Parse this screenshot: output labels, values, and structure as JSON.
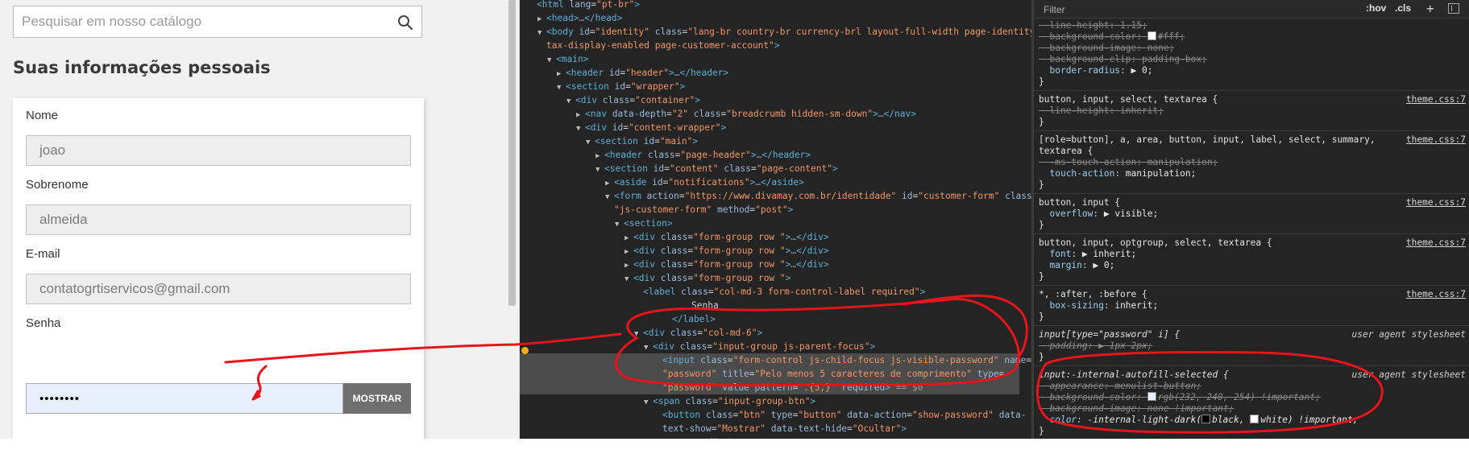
{
  "page": {
    "search": {
      "placeholder": "Pesquisar em nosso catálogo",
      "icon": "search-icon"
    },
    "title": "Suas informações pessoais",
    "fields": [
      {
        "label": "Nome",
        "value": "joao"
      },
      {
        "label": "Sobrenome",
        "value": "almeida"
      },
      {
        "label": "E-mail",
        "value": "contatogrtiservicos@gmail.com"
      },
      {
        "label": "Senha",
        "value": "••••••••"
      }
    ],
    "show_button": "MOSTRAR"
  },
  "elements_panel": {
    "lines": [
      {
        "indent": 0,
        "html": "<span class='tg'>&lt;html</span> <span class='an'>lang</span>=<span class='av'>\"pt-br\"</span><span class='tg'>&gt;</span>"
      },
      {
        "indent": 1,
        "tri": "▶",
        "html": "<span class='tg'>&lt;head&gt;</span><span class='dm'>…</span><span class='tg'>&lt;/head&gt;</span>"
      },
      {
        "indent": 1,
        "tri": "▼",
        "html": "<span class='tg'>&lt;body</span> <span class='an'>id</span>=<span class='av'>\"identity\"</span> <span class='an'>class</span>=<span class='av'>\"lang-br country-br currency-brl layout-full-width page-identity</span>"
      },
      {
        "indent": 1,
        "html": "<span class='av'>tax-display-enabled page-customer-account\"</span><span class='tg'>&gt;</span>"
      },
      {
        "indent": 2,
        "tri": "▼",
        "html": "<span class='tg'>&lt;main&gt;</span>"
      },
      {
        "indent": 3,
        "tri": "▶",
        "html": "<span class='tg'>&lt;header</span> <span class='an'>id</span>=<span class='av'>\"header\"</span><span class='tg'>&gt;</span><span class='dm'>…</span><span class='tg'>&lt;/header&gt;</span>"
      },
      {
        "indent": 3,
        "tri": "▼",
        "html": "<span class='tg'>&lt;section</span> <span class='an'>id</span>=<span class='av'>\"wrapper\"</span><span class='tg'>&gt;</span>"
      },
      {
        "indent": 4,
        "tri": "▼",
        "html": "<span class='tg'>&lt;div</span> <span class='an'>class</span>=<span class='av'>\"container\"</span><span class='tg'>&gt;</span>"
      },
      {
        "indent": 5,
        "tri": "▶",
        "html": "<span class='tg'>&lt;nav</span> <span class='an'>data-depth</span>=<span class='av'>\"2\"</span> <span class='an'>class</span>=<span class='av'>\"breadcrumb hidden-sm-down\"</span><span class='tg'>&gt;</span><span class='dm'>…</span><span class='tg'>&lt;/nav&gt;</span>"
      },
      {
        "indent": 5,
        "tri": "▼",
        "html": "<span class='tg'>&lt;div</span> <span class='an'>id</span>=<span class='av'>\"content-wrapper\"</span><span class='tg'>&gt;</span>"
      },
      {
        "indent": 6,
        "tri": "▼",
        "html": "<span class='tg'>&lt;section</span> <span class='an'>id</span>=<span class='av'>\"main\"</span><span class='tg'>&gt;</span>"
      },
      {
        "indent": 7,
        "tri": "▶",
        "html": "<span class='tg'>&lt;header</span> <span class='an'>class</span>=<span class='av'>\"page-header\"</span><span class='tg'>&gt;</span><span class='dm'>…</span><span class='tg'>&lt;/header&gt;</span>"
      },
      {
        "indent": 7,
        "tri": "▼",
        "html": "<span class='tg'>&lt;section</span> <span class='an'>id</span>=<span class='av'>\"content\"</span> <span class='an'>class</span>=<span class='av'>\"page-content\"</span><span class='tg'>&gt;</span>"
      },
      {
        "indent": 8,
        "tri": "▶",
        "html": "<span class='tg'>&lt;aside</span> <span class='an'>id</span>=<span class='av'>\"notifications\"</span><span class='tg'>&gt;</span><span class='dm'>…</span><span class='tg'>&lt;/aside&gt;</span>"
      },
      {
        "indent": 8,
        "tri": "▼",
        "html": "<span class='tg'>&lt;form</span> <span class='an'>action</span>=<span class='av'>\"https://www.divamay.com.br/identidade\"</span> <span class='an'>id</span>=<span class='av'>\"customer-form\"</span> <span class='an'>class</span>="
      },
      {
        "indent": 8,
        "html": "<span class='av'>\"js-customer-form\"</span> <span class='an'>method</span>=<span class='av'>\"post\"</span><span class='tg'>&gt;</span>"
      },
      {
        "indent": 9,
        "tri": "▼",
        "html": "<span class='tg'>&lt;section&gt;</span>"
      },
      {
        "indent": 10,
        "tri": "▶",
        "html": "<span class='tg'>&lt;div</span> <span class='an'>class</span>=<span class='av'>\"form-group row \"</span><span class='tg'>&gt;</span><span class='dm'>…</span><span class='tg'>&lt;/div&gt;</span>"
      },
      {
        "indent": 10,
        "tri": "▶",
        "html": "<span class='tg'>&lt;div</span> <span class='an'>class</span>=<span class='av'>\"form-group row \"</span><span class='tg'>&gt;</span><span class='dm'>…</span><span class='tg'>&lt;/div&gt;</span>"
      },
      {
        "indent": 10,
        "tri": "▶",
        "html": "<span class='tg'>&lt;div</span> <span class='an'>class</span>=<span class='av'>\"form-group row \"</span><span class='tg'>&gt;</span><span class='dm'>…</span><span class='tg'>&lt;/div&gt;</span>"
      },
      {
        "indent": 10,
        "tri": "▼",
        "html": "<span class='tg'>&lt;div</span> <span class='an'>class</span>=<span class='av'>\"form-group row \"</span><span class='tg'>&gt;</span>"
      },
      {
        "indent": 11,
        "html": "<span class='tg'>&lt;label</span> <span class='an'>class</span>=<span class='av'>\"col-md-3 form-control-label required\"</span><span class='tg'>&gt;</span>"
      },
      {
        "indent": 16,
        "html": "<span class='tx'>Senha</span>"
      },
      {
        "indent": 14,
        "html": "<span class='tg'>&lt;/label&gt;</span>"
      },
      {
        "indent": 11,
        "tri": "▼",
        "html": "<span class='tg'>&lt;div</span> <span class='an'>class</span>=<span class='av'>\"col-md-6\"</span><span class='tg'>&gt;</span>"
      },
      {
        "indent": 12,
        "tri": "▼",
        "html": "<span class='tg'>&lt;div</span> <span class='an'>class</span>=<span class='av'>\"input-group js-parent-focus\"</span><span class='tg'>&gt;</span>"
      },
      {
        "indent": 13,
        "sel": true,
        "html": "<span class='tg'>&lt;input</span> <span class='an'>class</span>=<span class='av'>\"form-control js-child-focus js-visible-password\"</span> <span class='an'>name</span>="
      },
      {
        "indent": 13,
        "sel": true,
        "html": "<span class='av'>\"password\"</span> <span class='an'>title</span>=<span class='av'>\"Pelo menos 5 caracteres de comprimento\"</span> <span class='an'>type</span>="
      },
      {
        "indent": 13,
        "sel": true,
        "html": "<span class='av'>\"password\"</span> <span class='an'>value</span> <span class='an'>pattern</span>=<span class='av'>\".{5,}\"</span> <span class='an'>required</span><span class='tg'>&gt;</span> <span class='dm'>== $0</span>"
      },
      {
        "indent": 12,
        "tri": "▼",
        "html": "<span class='tg'>&lt;span</span> <span class='an'>class</span>=<span class='av'>\"input-group-btn\"</span><span class='tg'>&gt;</span>"
      },
      {
        "indent": 13,
        "html": "<span class='tg'>&lt;button</span> <span class='an'>class</span>=<span class='av'>\"btn\"</span> <span class='an'>type</span>=<span class='av'>\"button\"</span> <span class='an'>data-action</span>=<span class='av'>\"show-password\"</span> <span class='an'>data-</span>"
      },
      {
        "indent": 13,
        "html": "<span class='an'>text-show</span>=<span class='av'>\"Mostrar\"</span> <span class='an'>data-text-hide</span>=<span class='av'>\"Ocultar\"</span><span class='tg'>&gt;</span>"
      },
      {
        "indent": 18,
        "html": "<span class='tx'>Mostrar</span>"
      }
    ]
  },
  "styles_panel": {
    "filter_placeholder": "Filter",
    "hov": ":hov",
    "cls": ".cls",
    "new_rule": "+",
    "lines": [
      {
        "html": "<span class='struck'>  <span class='prop'>line-height</span>: <span class='val'>1.15;</span></span>"
      },
      {
        "html": "<span class='struck'>  <span class='prop'>background-color</span>: <span class='swatch' style='background:#fff'></span><span class='val'>#fff;</span></span>"
      },
      {
        "html": "<span class='struck'>  <span class='prop'>background-image</span>: <span class='val'>none;</span></span>"
      },
      {
        "html": "<span class='struck'>  <span class='prop'>background-clip</span>: <span class='val'>padding-box;</span></span>"
      },
      {
        "html": "  <span class='prop'>border-radius</span>: <span class='val'>▶ 0;</span>"
      },
      {
        "html": "<span class='sel-txt'>}</span>"
      },
      {
        "sep": true
      },
      {
        "html": "<span class='sel-txt'>button, input, select, textarea {</span>",
        "src": "theme.css:7"
      },
      {
        "html": "<span class='struck'>  <span class='prop'>line-height</span>: <span class='val'>inherit;</span></span>"
      },
      {
        "html": "<span class='sel-txt'>}</span>"
      },
      {
        "sep": true
      },
      {
        "html": "<span class='sel-txt'>[role=button], a, area, button, input, label, select, summary,</span>",
        "src": "theme.css:7"
      },
      {
        "html": "<span class='sel-txt'>textarea {</span>"
      },
      {
        "html": "<span class='struck'>  <span class='prop'>-ms-touch-action</span>: <span class='val'>manipulation;</span></span>"
      },
      {
        "html": "  <span class='prop'>touch-action</span>: <span class='val'>manipulation;</span>"
      },
      {
        "html": "<span class='sel-txt'>}</span>"
      },
      {
        "sep": true
      },
      {
        "html": "<span class='sel-txt'>button, input {</span>",
        "src": "theme.css:7"
      },
      {
        "html": "  <span class='prop'>overflow</span>: <span class='val'>▶ visible;</span>"
      },
      {
        "html": "<span class='sel-txt'>}</span>"
      },
      {
        "sep": true
      },
      {
        "html": "<span class='sel-txt'>button, input, optgroup, select, textarea {</span>",
        "src": "theme.css:7"
      },
      {
        "html": "  <span class='prop'>font</span>: <span class='val'>▶ inherit;</span>"
      },
      {
        "html": "  <span class='prop'>margin</span>: <span class='val'>▶ 0;</span>"
      },
      {
        "html": "<span class='sel-txt'>}</span>"
      },
      {
        "sep": true
      },
      {
        "html": "<span class='sel-txt'>*, :after, :before {</span>",
        "src": "theme.css:7"
      },
      {
        "html": "  <span class='prop'>box-sizing</span>: <span class='val'>inherit;</span>"
      },
      {
        "html": "<span class='sel-txt'>}</span>"
      },
      {
        "sep": true
      },
      {
        "html": "<span class='sel-txt italic'>input[type=\"password\" i] {</span>",
        "ua": "user agent stylesheet"
      },
      {
        "html": "<span class='struck italic'>  <span class='prop'>padding</span>: <span class='val'>▶ 1px 2px;</span></span>"
      },
      {
        "html": "<span class='sel-txt'>}</span>"
      },
      {
        "sep": true
      },
      {
        "html": "<span class='sel-txt italic'>input:-internal-autofill-selected {</span>",
        "ua": "user agent stylesheet"
      },
      {
        "html": "<span class='struck italic'>  <span class='prop'>appearance</span>: <span class='val'>menulist-button;</span></span>"
      },
      {
        "html": "<span class='struck italic'>  <span class='prop'>background-color</span>: <span class='swatch' style='background:#e8f0fe'></span><span class='val'>rgb(232, 240, 254) !important;</span></span>"
      },
      {
        "html": "<span class='struck italic'>  <span class='prop'>background-image</span>: <span class='val'>none !important;</span></span>"
      },
      {
        "html": "<span class='italic'>  <span class='prop'>color</span>: <span class='val'>-internal-light-dark(<span class='swatch' style='background:#000'></span>black, <span class='swatch' style='background:#fff'></span>white) !important;</span></span>"
      },
      {
        "html": "<span class='sel-txt'>}</span>"
      }
    ]
  },
  "colors": {
    "devtools_bg": "#242424",
    "tag": "#5db0d7",
    "attr_name": "#9bbbdc",
    "attr_value": "#f29766",
    "annotation_red": "#e8141b",
    "autofill_bg": "#e8f0fe"
  }
}
